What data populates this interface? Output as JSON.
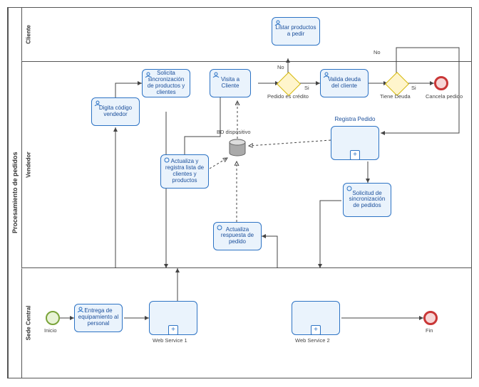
{
  "pool": "Procesamiento de pedidos",
  "lanes": {
    "cliente": "Cliente",
    "vendedor": "Vendedor",
    "sede": "Sede Central"
  },
  "events": {
    "inicio": "Inicio",
    "fin": "Fin",
    "cancela": "Cancela pedido"
  },
  "gateways": {
    "credito": {
      "label": "Pedido es crédito",
      "yes": "Si",
      "no": "No"
    },
    "deuda": {
      "label": "Tiene Deuda",
      "yes": "Si",
      "no": "No"
    }
  },
  "db": "BD dispositivo",
  "tasks": {
    "listar": "Listar productos a pedir",
    "visita": "Visita a Cliente",
    "valida": "Valida deuda del cliente",
    "digita": "Digita código vendedor",
    "solSync": "Solicita sincronización de productos y clientes",
    "actLista": "Actualiza y registra lista de clientes y productos",
    "actResp": "Actualiza respuesta de pedido",
    "registra": "Registra Pedido",
    "solPed": "Solicitud de sincronización de pedidos",
    "entrega": "Entrega de equipamiento al personal",
    "ws1": "Web Service 1",
    "ws2": "Web Service 2"
  }
}
